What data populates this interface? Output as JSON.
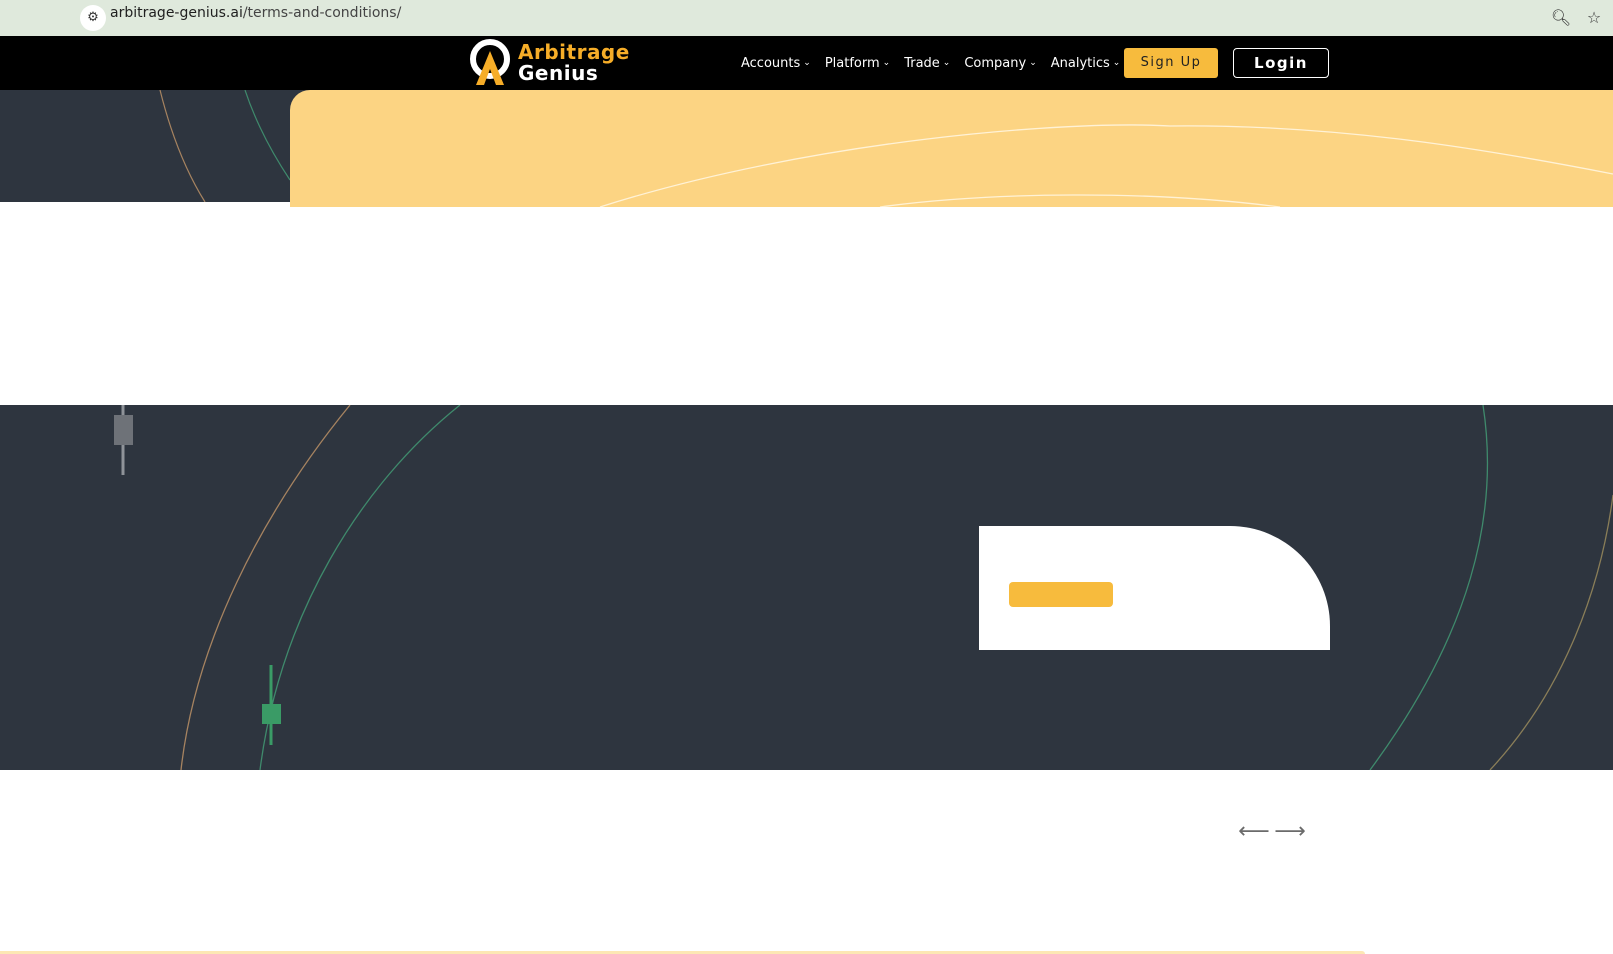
{
  "browser": {
    "url_host": "arbitrage-genius.ai",
    "url_path": "/terms-and-conditions/",
    "icons": [
      "forward-icon",
      "reload-icon",
      "site-info-icon",
      "zoom-icon",
      "bookmark-star-icon"
    ]
  },
  "logo": {
    "line1": "Arbitrage",
    "line2": "Genius"
  },
  "nav": {
    "items": [
      {
        "label": "Accounts"
      },
      {
        "label": "Platform"
      },
      {
        "label": "Trade"
      },
      {
        "label": "Company"
      },
      {
        "label": "Analytics"
      }
    ],
    "signup_label": "Sign Up",
    "login_label": "Login"
  },
  "carousel": {
    "prev": "⟵",
    "next": "⟶"
  },
  "colors": {
    "brand_yellow": "#f7bb3d",
    "hero_yellow": "#fcd483",
    "dark_bg": "#2e353f",
    "header_bg": "#000000",
    "candle_green": "#3a9b66"
  }
}
